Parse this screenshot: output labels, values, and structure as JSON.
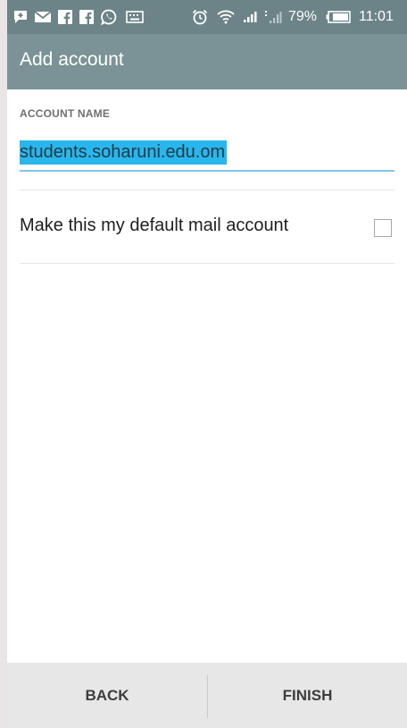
{
  "status_bar": {
    "icons": [
      "plus-chat-icon",
      "mail-icon",
      "facebook-icon",
      "facebook-icon",
      "whatsapp-icon",
      "keyboard-icon",
      "alarm-icon",
      "wifi-icon",
      "signal-icon",
      "signal-icon"
    ],
    "battery_percent": "79%",
    "time": "11:01"
  },
  "app_bar": {
    "title": "Add account"
  },
  "form": {
    "account_name_label": "ACCOUNT NAME",
    "account_name_value": "students.soharuni.edu.om",
    "default_account_label": "Make this my default mail account",
    "default_account_checked": false
  },
  "bottom_bar": {
    "back_label": "BACK",
    "finish_label": "FINISH"
  },
  "colors": {
    "status_bar_bg": "#6c8488",
    "app_bar_bg": "#7b9396",
    "selection_highlight": "#29b6ec",
    "input_underline": "#7fc8e8",
    "bottom_bar_bg": "#e7e7e7"
  }
}
